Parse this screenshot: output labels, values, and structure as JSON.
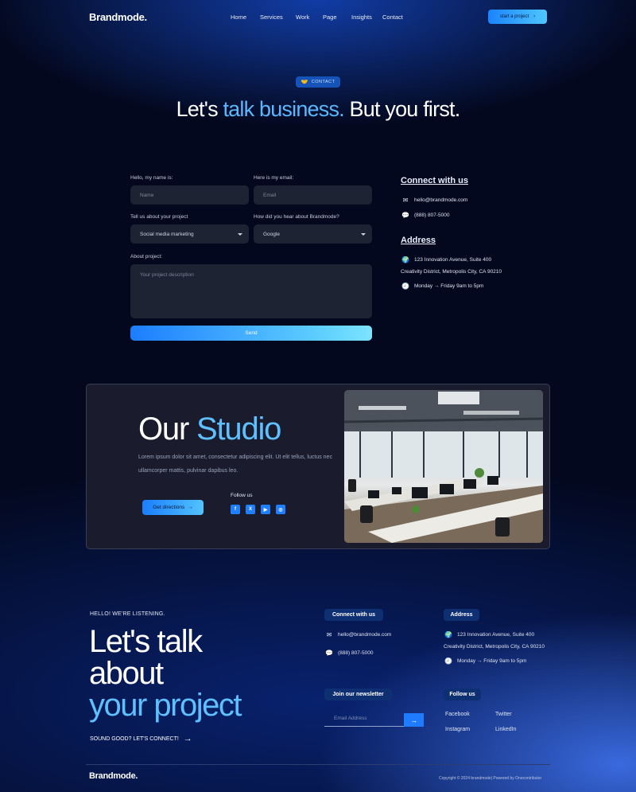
{
  "brand": {
    "logo_text": "Brandmode."
  },
  "nav": {
    "items": [
      {
        "label": "Home"
      },
      {
        "label": "Services"
      },
      {
        "label": "Work"
      },
      {
        "label": "Page"
      },
      {
        "label": "Insights"
      },
      {
        "label": "Contact"
      }
    ],
    "cta_label": "start a project"
  },
  "hero": {
    "badge": "CONTACT",
    "title_part1": "Let's ",
    "title_accent": "talk business.",
    "title_part2": " But you first."
  },
  "form": {
    "name_label": "Hello, my name is:",
    "name_placeholder": "Name",
    "email_label": "Here is my email:",
    "email_placeholder": "Email",
    "project_label": "Tell us about your project",
    "project_value": "Social media marketing",
    "hear_label": "How did you hear about Brandmode?",
    "hear_value": "Google",
    "about_label": "About project:",
    "about_placeholder": "Your project description",
    "send_label": "Send"
  },
  "contact_side": {
    "connect_heading": "Connect with us",
    "email": "hello@brandmode.com",
    "phone": "(888) 807-5000",
    "address_heading": "Address",
    "address_line1": "123 Innovation Avenue, Suite 400",
    "address_line2": "Creativity District, Metropolis City, CA 90210",
    "hours": "Monday → Friday 9am to 5pm"
  },
  "studio": {
    "title_part1": "Our ",
    "title_accent": "Studio",
    "description": "Lorem ipsum dolor sit amet, consectetur adipiscing elit. Ut elit tellus, luctus nec ullamcorper mattis, pulvinar dapibus leo.",
    "button_label": "Get directions",
    "follow_label": "Follow us",
    "socials": [
      "facebook-icon",
      "x-icon",
      "youtube-icon",
      "instagram-icon"
    ]
  },
  "footer": {
    "hello": "HELLO! WE'RE LISTENING.",
    "big_line1": "Let's talk",
    "big_line2": "about",
    "big_line3": "your project",
    "sound_good": "SOUND GOOD? LET'S CONNECT!",
    "connect_tag": "Connect with us",
    "email": "hello@brandmode.com",
    "phone": "(888) 807-5000",
    "address_tag": "Address",
    "address_line1": "123 Innovation Avenue, Suite 400",
    "address_line2": "Creativity District, Metropolis City, CA 90210",
    "hours": "Monday → Friday 9am to 5pm",
    "newsletter_tag": "Join our newsletter",
    "newsletter_placeholder": "Email Address",
    "follow_tag": "Follow us",
    "social_links": [
      "Facebook",
      "Twitter",
      "Instagram",
      "LinkedIn"
    ],
    "logo_text": "Brandmode.",
    "copyright": "Copyright © 2024 brandmode| Powered by Onecontributor"
  },
  "colors": {
    "accent": "#5ab8ff",
    "button_blue": "#1f7bff",
    "background": "#03081e",
    "card": "#1a1c2e"
  }
}
